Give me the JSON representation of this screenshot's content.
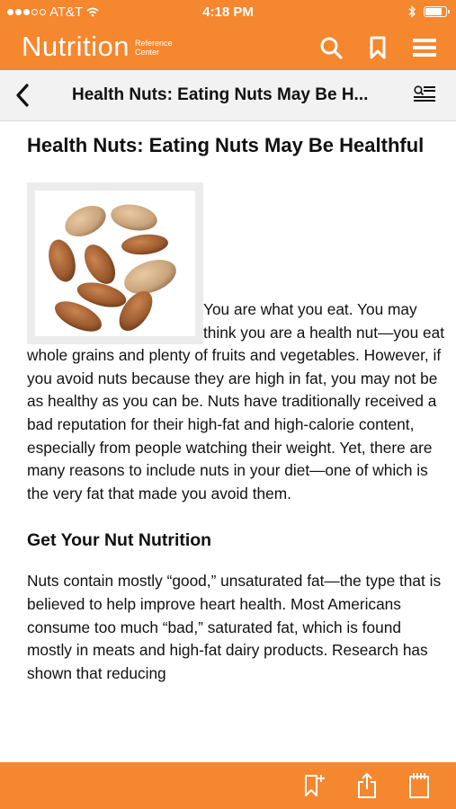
{
  "status_bar": {
    "carrier": "AT&T",
    "time": "4:18 PM"
  },
  "app_bar": {
    "brand_name": "Nutrition",
    "brand_sub_line1": "Reference",
    "brand_sub_line2": "Center",
    "icons": [
      "search-icon",
      "bookmark-icon",
      "menu-icon"
    ]
  },
  "nav_bar": {
    "title": "Health Nuts: Eating Nuts May Be H...",
    "icons": [
      "back-chevron-icon",
      "table-of-contents-icon"
    ]
  },
  "article": {
    "title": "Health Nuts: Eating Nuts May Be Healthful",
    "intro": "You are what you eat. You may think you are a health nut—you eat whole grains and plenty of fruits and vegetables. However, if you avoid nuts because they are high in fat, you may not be as healthy as you can be. Nuts have traditionally received a bad reputation for their high-fat and high-calorie content, especially from people watching their weight. Yet, there are many reasons to include nuts in your diet—one of which is the very fat that made you avoid them.",
    "section_heading": "Get Your Nut Nutrition",
    "section_text": "Nuts contain mostly “good,” unsaturated fat—the type that is believed to help improve heart health. Most Americans consume too much “bad,” saturated fat, which is found mostly in meats and high-fat dairy products. Research has shown that reducing"
  },
  "bottom_bar": {
    "icons": [
      "add-bookmark-icon",
      "share-icon",
      "notes-icon"
    ]
  },
  "colors": {
    "brand_orange": "#f5872f",
    "nav_gray": "#f2f2f2",
    "text": "#111111"
  }
}
